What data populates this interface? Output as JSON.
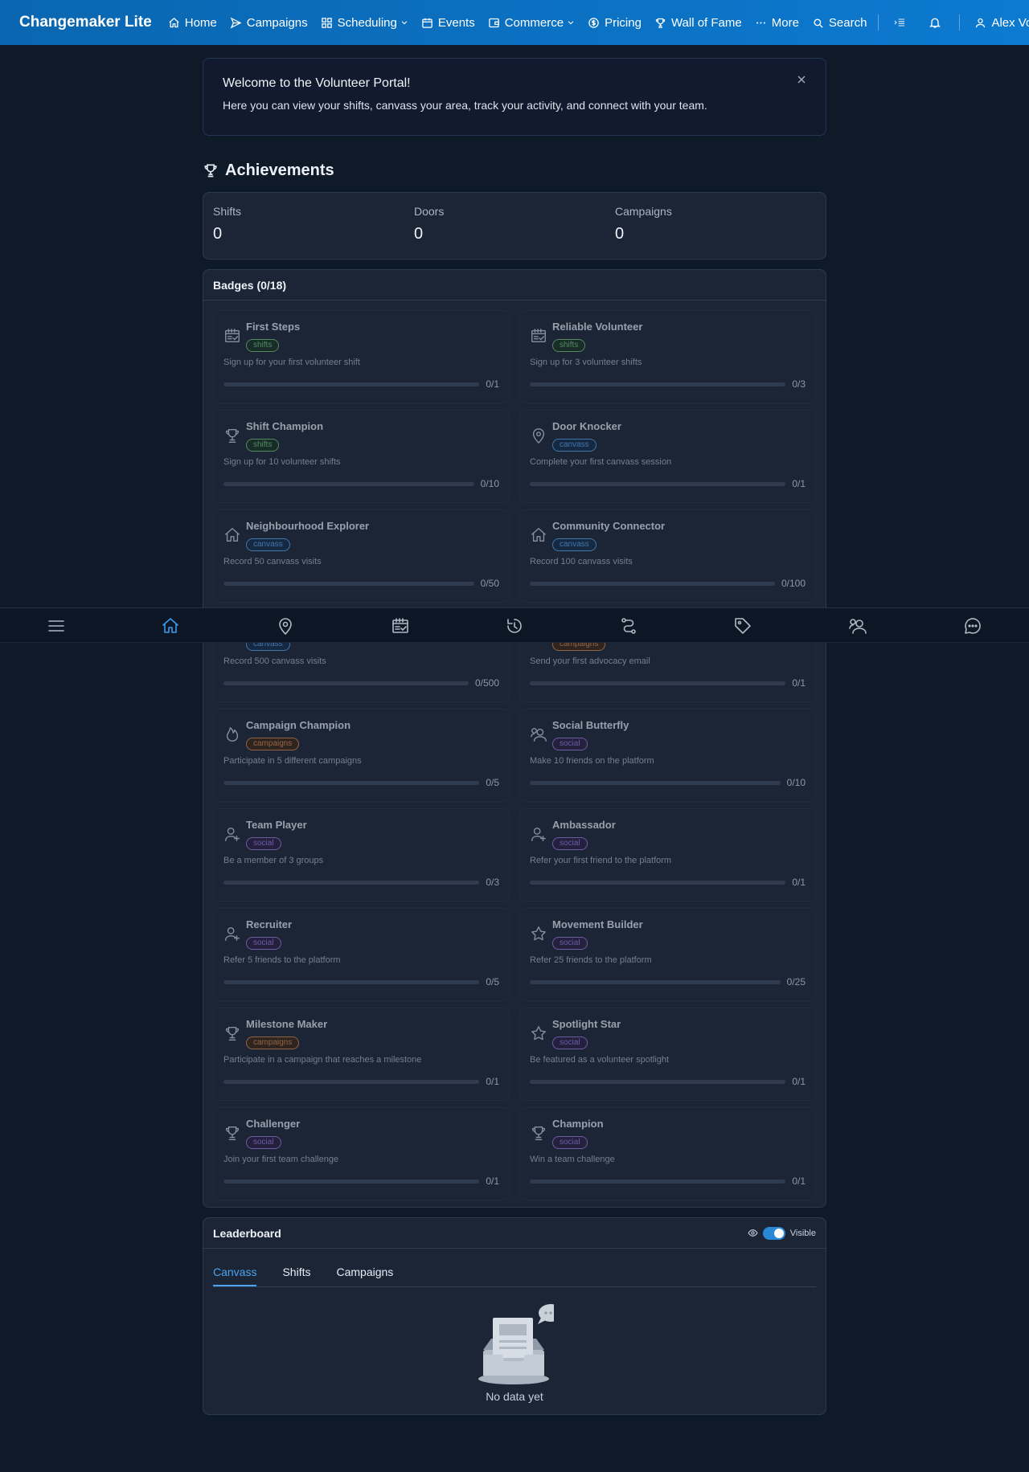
{
  "nav": {
    "brand": "Changemaker Lite",
    "items": [
      {
        "label": "Home",
        "icon": "home-icon"
      },
      {
        "label": "Campaigns",
        "icon": "send-icon"
      },
      {
        "label": "Scheduling",
        "icon": "grid-icon"
      },
      {
        "label": "Events",
        "icon": "calendar-icon"
      },
      {
        "label": "Commerce",
        "icon": "wallet-icon"
      },
      {
        "label": "Pricing",
        "icon": "dollar-circle-icon"
      },
      {
        "label": "Wall of Fame",
        "icon": "trophy-icon"
      },
      {
        "label": "More",
        "icon": "ellipsis-icon"
      },
      {
        "label": "Search",
        "icon": "search-icon"
      }
    ],
    "user": "Alex Volunteer"
  },
  "welcome": {
    "title": "Welcome to the Volunteer Portal!",
    "body": "Here you can view your shifts, canvass your area, track your activity, and connect with your team."
  },
  "achievements": {
    "title": "Achievements",
    "stats": [
      {
        "label": "Shifts",
        "value": "0"
      },
      {
        "label": "Doors",
        "value": "0"
      },
      {
        "label": "Campaigns",
        "value": "0"
      }
    ]
  },
  "badges": {
    "title": "Badges (0/18)",
    "items": [
      {
        "name": "First Steps",
        "tag": "shifts",
        "desc": "Sign up for your first volunteer shift",
        "count": "0/1",
        "progress": 0,
        "icon": "calendar-check-icon"
      },
      {
        "name": "Reliable Volunteer",
        "tag": "shifts",
        "desc": "Sign up for 3 volunteer shifts",
        "count": "0/3",
        "progress": 0,
        "icon": "calendar-check-icon"
      },
      {
        "name": "Shift Champion",
        "tag": "shifts",
        "desc": "Sign up for 10 volunteer shifts",
        "count": "0/10",
        "progress": 0,
        "icon": "trophy-icon"
      },
      {
        "name": "Door Knocker",
        "tag": "canvass",
        "desc": "Complete your first canvass session",
        "count": "0/1",
        "progress": 0,
        "icon": "map-pin-icon"
      },
      {
        "name": "Neighbourhood Explorer",
        "tag": "canvass",
        "desc": "Record 50 canvass visits",
        "count": "0/50",
        "progress": 0,
        "icon": "home-icon"
      },
      {
        "name": "Community Connector",
        "tag": "canvass",
        "desc": "Record 100 canvass visits",
        "count": "0/100",
        "progress": 0,
        "icon": "home-icon"
      },
      {
        "name": "",
        "tag": "canvass",
        "desc": "Record 500 canvass visits",
        "count": "0/500",
        "progress": 0,
        "icon": "home-icon"
      },
      {
        "name": "",
        "tag": "campaigns",
        "desc": "Send your first advocacy email",
        "count": "0/1",
        "progress": 0,
        "icon": "mail-icon"
      },
      {
        "name": "Campaign Champion",
        "tag": "campaigns",
        "desc": "Participate in 5 different campaigns",
        "count": "0/5",
        "progress": 0,
        "icon": "flame-icon"
      },
      {
        "name": "Social Butterfly",
        "tag": "social",
        "desc": "Make 10 friends on the platform",
        "count": "0/10",
        "progress": 0,
        "icon": "users-icon"
      },
      {
        "name": "Team Player",
        "tag": "social",
        "desc": "Be a member of 3 groups",
        "count": "0/3",
        "progress": 0,
        "icon": "user-add-icon"
      },
      {
        "name": "Ambassador",
        "tag": "social",
        "desc": "Refer your first friend to the platform",
        "count": "0/1",
        "progress": 0,
        "icon": "user-add-icon"
      },
      {
        "name": "Recruiter",
        "tag": "social",
        "desc": "Refer 5 friends to the platform",
        "count": "0/5",
        "progress": 0,
        "icon": "user-add-icon"
      },
      {
        "name": "Movement Builder",
        "tag": "social",
        "desc": "Refer 25 friends to the platform",
        "count": "0/25",
        "progress": 0,
        "icon": "star-icon"
      },
      {
        "name": "Milestone Maker",
        "tag": "campaigns",
        "desc": "Participate in a campaign that reaches a milestone",
        "count": "0/1",
        "progress": 0,
        "icon": "trophy-icon"
      },
      {
        "name": "Spotlight Star",
        "tag": "social",
        "desc": "Be featured as a volunteer spotlight",
        "count": "0/1",
        "progress": 0,
        "icon": "star-icon"
      },
      {
        "name": "Challenger",
        "tag": "social",
        "desc": "Join your first team challenge",
        "count": "0/1",
        "progress": 0,
        "icon": "trophy-icon"
      },
      {
        "name": "Champion",
        "tag": "social",
        "desc": "Win a team challenge",
        "count": "0/1",
        "progress": 0,
        "icon": "trophy-icon"
      }
    ]
  },
  "leaderboard": {
    "title": "Leaderboard",
    "visibility_label": "Visible",
    "visible": true,
    "tabs": [
      "Canvass",
      "Shifts",
      "Campaigns"
    ],
    "active_tab": 0,
    "empty_text": "No data yet"
  },
  "bottom_nav": {
    "items": [
      "menu-icon",
      "home-icon",
      "map-pin-icon",
      "calendar-check-icon",
      "history-icon",
      "route-icon",
      "tag-icon",
      "users-icon",
      "chat-icon"
    ],
    "active": 1
  },
  "colors": {
    "brand": "#0b72c4",
    "accent": "#2a8fe0",
    "background": "#0f1a29"
  }
}
